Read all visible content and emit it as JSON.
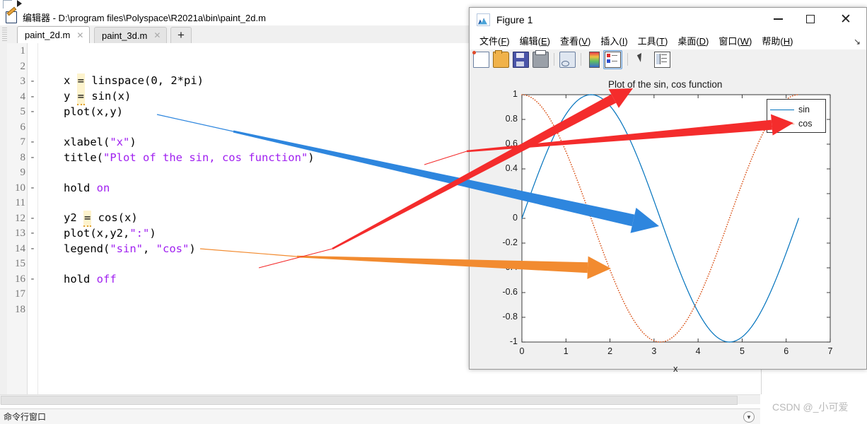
{
  "editor": {
    "title": "编辑器 - D:\\program files\\Polyspace\\R2021a\\bin\\paint_2d.m",
    "icon": "editor-pencil-icon",
    "tabs": [
      {
        "label": "paint_2d.m",
        "close": "✕",
        "active": true
      },
      {
        "label": "paint_3d.m",
        "close": "✕",
        "active": false
      }
    ],
    "new_tab_label": "+",
    "status_label": "命令行窗口",
    "status_drop": "▼",
    "lines": [
      {
        "num": "1",
        "mark": "",
        "text": ""
      },
      {
        "num": "2",
        "mark": "",
        "text": ""
      },
      {
        "num": "3",
        "mark": "-",
        "text": "x = linspace(0, 2*pi)"
      },
      {
        "num": "4",
        "mark": "-",
        "text": "y = sin(x)"
      },
      {
        "num": "5",
        "mark": "-",
        "text": "plot(x,y)"
      },
      {
        "num": "6",
        "mark": "",
        "text": ""
      },
      {
        "num": "7",
        "mark": "-",
        "text": "xlabel(\"x\")"
      },
      {
        "num": "8",
        "mark": "-",
        "text": "title(\"Plot of the sin, cos function\")"
      },
      {
        "num": "9",
        "mark": "",
        "text": ""
      },
      {
        "num": "10",
        "mark": "-",
        "text": "hold on"
      },
      {
        "num": "11",
        "mark": "",
        "text": ""
      },
      {
        "num": "12",
        "mark": "-",
        "text": "y2 = cos(x)"
      },
      {
        "num": "13",
        "mark": "-",
        "text": "plot(x,y2,\":\")"
      },
      {
        "num": "14",
        "mark": "-",
        "text": "legend(\"sin\", \"cos\")"
      },
      {
        "num": "15",
        "mark": "",
        "text": ""
      },
      {
        "num": "16",
        "mark": "-",
        "text": "hold off"
      },
      {
        "num": "17",
        "mark": "",
        "text": ""
      },
      {
        "num": "18",
        "mark": "",
        "text": ""
      }
    ]
  },
  "watermark": "CSDN @_小可爱",
  "figure": {
    "title": "Figure 1",
    "icon": "matlab-figure-icon",
    "window_buttons": {
      "minimize": "minimize-icon",
      "maximize": "maximize-icon",
      "close": "close-icon"
    },
    "menus": [
      {
        "text": "文件",
        "mnemonic": "F"
      },
      {
        "text": "编辑",
        "mnemonic": "E"
      },
      {
        "text": "查看",
        "mnemonic": "V"
      },
      {
        "text": "插入",
        "mnemonic": "I"
      },
      {
        "text": "工具",
        "mnemonic": "T"
      },
      {
        "text": "桌面",
        "mnemonic": "D"
      },
      {
        "text": "窗口",
        "mnemonic": "W"
      },
      {
        "text": "帮助",
        "mnemonic": "H"
      }
    ],
    "menu_overflow": "↘",
    "toolbar": [
      {
        "name": "new-figure-icon"
      },
      {
        "name": "open-file-icon"
      },
      {
        "name": "save-figure-icon"
      },
      {
        "name": "print-figure-icon"
      },
      {
        "name": "link-plot-icon"
      },
      {
        "name": "colorbar-icon"
      },
      {
        "name": "legend-icon",
        "active": true
      },
      {
        "name": "edit-plot-pointer-icon"
      },
      {
        "name": "plot-browser-icon"
      }
    ]
  },
  "chart_data": {
    "type": "line",
    "title": "Plot of the sin, cos function",
    "xlabel": "x",
    "ylabel": "",
    "xlim": [
      0,
      7
    ],
    "ylim": [
      -1,
      1
    ],
    "xticks": [
      "0",
      "1",
      "2",
      "3",
      "4",
      "5",
      "6",
      "7"
    ],
    "yticks": [
      "1",
      "0.8",
      "0.6",
      "0.4",
      "0.2",
      "0",
      "-0.2",
      "-0.4",
      "-0.6",
      "-0.8",
      "-1"
    ],
    "grid": false,
    "legend": {
      "position": "top-right",
      "entries": [
        "sin",
        "cos"
      ]
    },
    "series": [
      {
        "name": "sin",
        "color": "#0072BD",
        "style": "solid",
        "fn": "sin",
        "x": [
          0,
          0.31,
          0.63,
          0.94,
          1.26,
          1.57,
          1.88,
          2.2,
          2.51,
          2.83,
          3.14,
          3.46,
          3.77,
          4.08,
          4.4,
          4.71,
          5.03,
          5.34,
          5.65,
          5.97,
          6.28
        ],
        "y": [
          0,
          0.309,
          0.588,
          0.809,
          0.951,
          1.0,
          0.951,
          0.809,
          0.588,
          0.309,
          0,
          -0.309,
          -0.588,
          -0.809,
          -0.951,
          -1.0,
          -0.951,
          -0.809,
          -0.588,
          -0.309,
          0
        ]
      },
      {
        "name": "cos",
        "color": "#D95319",
        "style": "dotted",
        "fn": "cos",
        "x": [
          0,
          0.31,
          0.63,
          0.94,
          1.26,
          1.57,
          1.88,
          2.2,
          2.51,
          2.83,
          3.14,
          3.46,
          3.77,
          4.08,
          4.4,
          4.71,
          5.03,
          5.34,
          5.65,
          5.97,
          6.28
        ],
        "y": [
          1.0,
          0.951,
          0.809,
          0.588,
          0.309,
          0,
          -0.309,
          -0.588,
          -0.809,
          -0.951,
          -1.0,
          -0.951,
          -0.809,
          -0.588,
          -0.309,
          0,
          0.309,
          0.588,
          0.809,
          0.951,
          1.0
        ]
      }
    ]
  },
  "annotations": {
    "blue_arrow": {
      "color": "#2E86DE",
      "from_label": "plot(x,y)",
      "to_label": "sin-curve"
    },
    "orange_arrow": {
      "color": "#F28B30",
      "from_label": "plot(x,y2,\":\")",
      "to_label": "cos-curve"
    },
    "red_arrow_title": {
      "color": "#F42C2C",
      "from_label": "title-string",
      "to_label": "chart-title"
    },
    "red_arrow_legend": {
      "color": "#F42C2C",
      "from_label": "legend-call",
      "to_label": "chart-legend"
    }
  },
  "colors": {
    "sin": "#0072BD",
    "cos": "#D95319",
    "annot_blue": "#2E86DE",
    "annot_orange": "#F28B30",
    "annot_red": "#F42C2C",
    "figure_bg": "#F0F0F0",
    "axes_bg": "#FFFFFF"
  }
}
